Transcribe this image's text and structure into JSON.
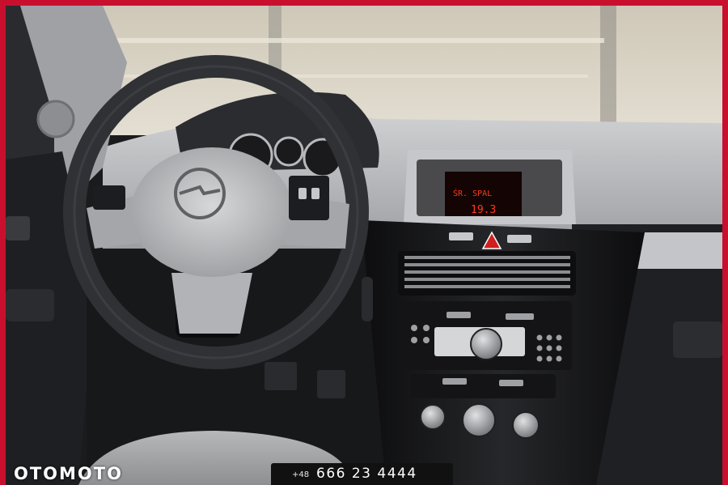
{
  "photo": {
    "subject": "Opel car dashboard interior with steering wheel and center console",
    "colors": {
      "frame_red": "#c8102e",
      "display_text": "#ff3b1f",
      "plastic_dark": "#1b1b1d",
      "windshield": "#d9d2c2"
    }
  },
  "display": {
    "line1": "ŚR. SPAL",
    "line2": "19.3"
  },
  "steering_wheel": {
    "logo_icon": "opel-logo"
  },
  "watermark": {
    "brand": "OTOMOTO"
  },
  "contact": {
    "prefix": "+48",
    "number": "666 23 4444"
  }
}
